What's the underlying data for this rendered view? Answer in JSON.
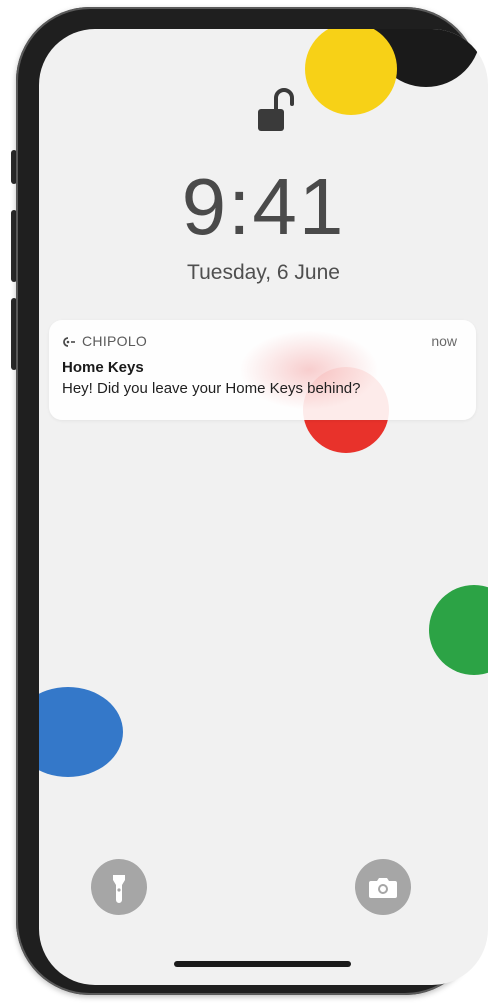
{
  "lock_screen": {
    "time": "9:41",
    "date": "Tuesday, 6 June",
    "lock_state_icon": "unlocked-padlock-icon"
  },
  "notification": {
    "app_icon": "chipolo-app-icon",
    "app_name": "CHIPOLO",
    "time": "now",
    "title": "Home Keys",
    "body": "Hey! Did you leave your Home Keys behind?"
  },
  "quick_actions": {
    "left_icon": "flashlight-icon",
    "right_icon": "camera-icon"
  },
  "colors": {
    "wallpaper": "#f1f1f1",
    "dot_yellow": "#f7d117",
    "dot_black": "#1a1a1a",
    "dot_red": "#e8322b",
    "dot_green": "#2ca345",
    "dot_blue": "#3478c9",
    "frame": "#1f1f1f"
  }
}
